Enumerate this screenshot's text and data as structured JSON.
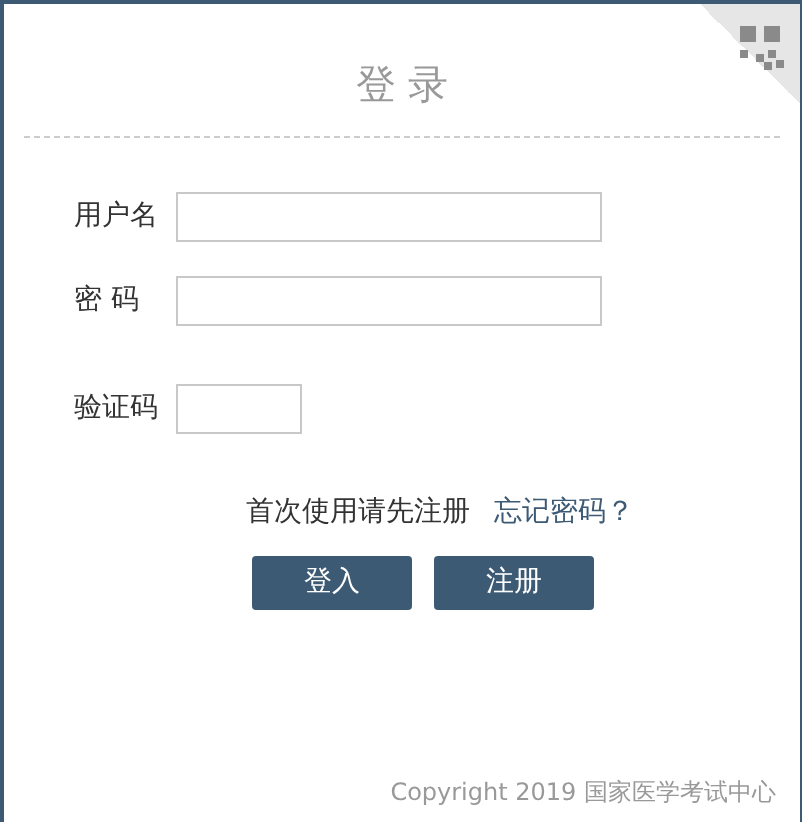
{
  "title": "登 录",
  "fields": [
    {
      "label": "用户名",
      "kind": "wide"
    },
    {
      "label": "密 码",
      "kind": "wide"
    },
    {
      "label": "验证码",
      "kind": "short"
    }
  ],
  "register_hint": "首次使用请先注册",
  "forgot_link": "忘记密码？",
  "buttons": [
    "登入",
    "注册"
  ],
  "footer": "Copyright 2019 国家医学考试中心"
}
